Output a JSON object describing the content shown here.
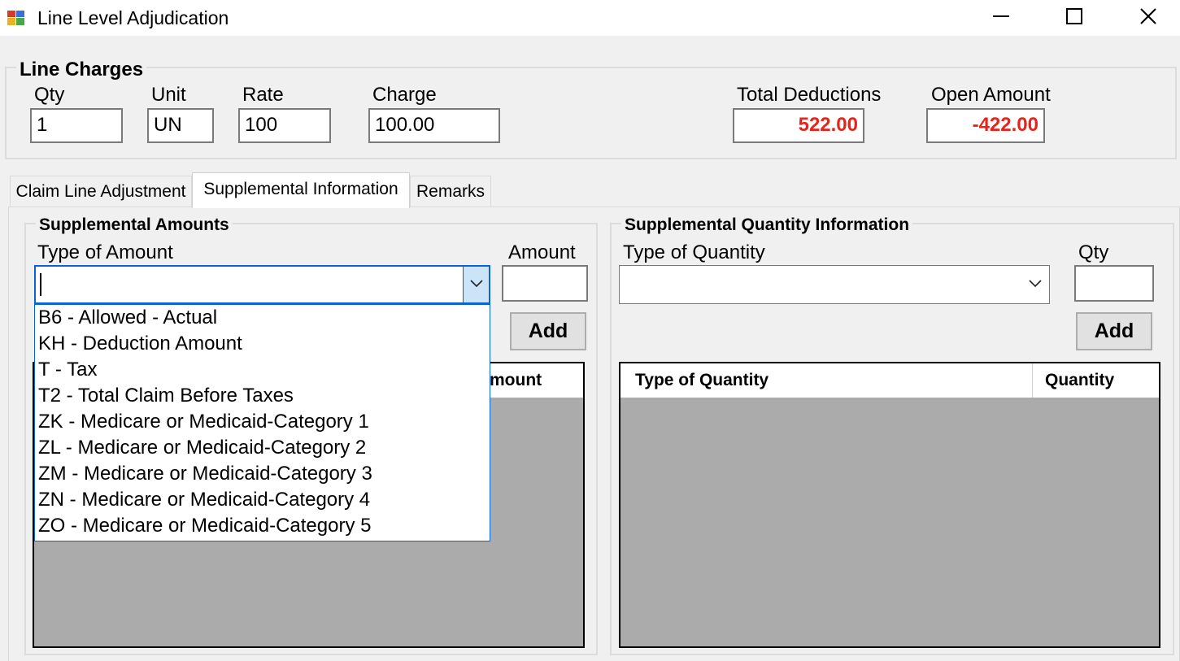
{
  "window": {
    "title": "Line Level Adjudication"
  },
  "line_charges": {
    "legend": "Line Charges",
    "qty": {
      "label": "Qty",
      "value": "1"
    },
    "unit": {
      "label": "Unit",
      "value": "UN"
    },
    "rate": {
      "label": "Rate",
      "value": "100"
    },
    "charge": {
      "label": "Charge",
      "value": "100.00"
    },
    "total_deductions": {
      "label": "Total Deductions",
      "value": "522.00"
    },
    "open_amount": {
      "label": "Open Amount",
      "value": "-422.00"
    },
    "accent_red": "#e8231a"
  },
  "tabs": [
    {
      "label": "Claim Line Adjustment",
      "active": false
    },
    {
      "label": "Supplemental Information",
      "active": true
    },
    {
      "label": "Remarks",
      "active": false
    }
  ],
  "supplemental_amounts": {
    "legend": "Supplemental Amounts",
    "type_label": "Type of Amount",
    "type_value": "",
    "amount_label": "Amount",
    "amount_value": "",
    "add_label": "Add",
    "grid_column_partial": "mount",
    "dropdown_options": [
      "B6 - Allowed - Actual",
      "KH - Deduction Amount",
      "T - Tax",
      "T2 - Total Claim Before Taxes",
      "ZK - Medicare or Medicaid-Category 1",
      "ZL - Medicare or Medicaid-Category 2",
      "ZM - Medicare or Medicaid-Category 3",
      "ZN - Medicare or Medicaid-Category 4",
      "ZO - Medicare or Medicaid-Category 5"
    ]
  },
  "supplemental_quantity": {
    "legend": "Supplemental Quantity Information",
    "type_label": "Type of Quantity",
    "type_value": "",
    "qty_label": "Qty",
    "qty_value": "",
    "add_label": "Add",
    "grid_columns": [
      "Type of Quantity",
      "Quantity"
    ]
  },
  "icons": {
    "app": "app-icon",
    "minimize": "minimize-icon",
    "maximize": "maximize-icon",
    "close": "close-icon",
    "dropdown": "chevron-down-icon"
  }
}
